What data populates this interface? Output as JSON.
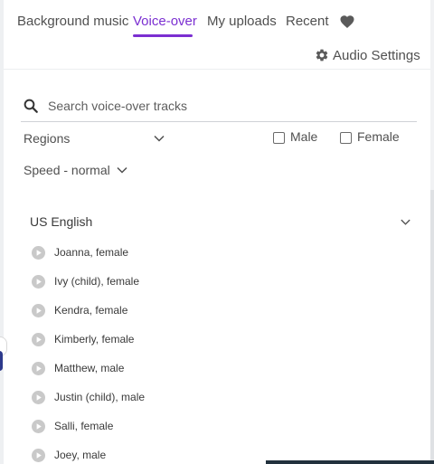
{
  "tabs": [
    {
      "label": "Background music",
      "active": false
    },
    {
      "label": "Voice-over",
      "active": true
    },
    {
      "label": "My uploads",
      "active": false
    },
    {
      "label": "Recent",
      "active": false
    }
  ],
  "icons": {
    "favorites": "heart-icon",
    "settings": "gear-icon",
    "search": "search-icon",
    "play": "play-icon",
    "chevron": "chevron-down-icon"
  },
  "audio_settings": {
    "label": "Audio Settings"
  },
  "search": {
    "placeholder": "Search voice-over tracks",
    "value": ""
  },
  "filters": {
    "regions_label": "Regions",
    "speed_label": "Speed - normal",
    "male_label": "Male",
    "female_label": "Female",
    "male_checked": false,
    "female_checked": false
  },
  "group": {
    "label": "US English"
  },
  "voices": [
    {
      "name": "Joanna, female"
    },
    {
      "name": "Ivy (child), female"
    },
    {
      "name": "Kendra, female"
    },
    {
      "name": "Kimberly, female"
    },
    {
      "name": "Matthew, male"
    },
    {
      "name": "Justin (child), male"
    },
    {
      "name": "Salli, female"
    },
    {
      "name": "Joey, male"
    }
  ],
  "colors": {
    "accent": "#7b2fd1",
    "text": "#505050",
    "icon_gray": "#5a5a5a",
    "play_gray": "#c9c9c9"
  }
}
